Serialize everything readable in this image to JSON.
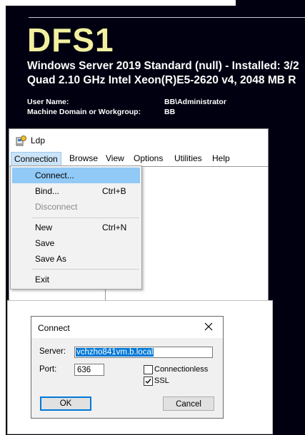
{
  "bginfo": {
    "hostname": "DFS1",
    "os_line": "Windows Server 2019 Standard (null) - Installed: 3/2",
    "cpu_line": "Quad 2.10 GHz Intel Xeon(R)E5-2620 v4,  2048 MB R",
    "user_label": "User Name:",
    "user_value": "BB\\Administrator",
    "domain_label": "Machine Domain or Workgroup:",
    "domain_value": "BB"
  },
  "ldp": {
    "title": "Ldp",
    "menu": [
      "Connection",
      "Browse",
      "View",
      "Options",
      "Utilities",
      "Help"
    ],
    "connection_menu": {
      "connect": "Connect...",
      "bind": "Bind...",
      "bind_shortcut": "Ctrl+B",
      "disconnect": "Disconnect",
      "new": "New",
      "new_shortcut": "Ctrl+N",
      "save": "Save",
      "save_as": "Save As",
      "exit": "Exit"
    }
  },
  "connect_dialog": {
    "title": "Connect",
    "server_label": "Server:",
    "server_value": "vchzho841vm.b.local",
    "port_label": "Port:",
    "port_value": "636",
    "connectionless_label": "Connectionless",
    "connectionless_checked": false,
    "ssl_label": "SSL",
    "ssl_checked": true,
    "ok_label": "OK",
    "cancel_label": "Cancel"
  },
  "colors": {
    "desktop_bg": "#000010",
    "hostname_color": "#f2f0a0",
    "menu_highlight": "#91c9f7",
    "default_button_border": "#0078d7"
  }
}
